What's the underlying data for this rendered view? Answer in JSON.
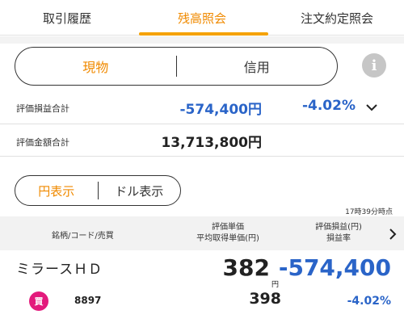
{
  "tabs": [
    {
      "label": "取引履歴",
      "active": false
    },
    {
      "label": "残高照会",
      "active": true
    },
    {
      "label": "注文約定照会",
      "active": false
    }
  ],
  "account_type": {
    "options": [
      "現物",
      "信用"
    ],
    "selected": "現物"
  },
  "info_icon": "info-icon",
  "summary": {
    "pl_label": "評価損益合計",
    "pl_total": "-574,400円",
    "pl_rate": "-4.02%",
    "mv_label": "評価金額合計",
    "mv_total": "13,713,800円"
  },
  "currency": {
    "options": [
      "円表示",
      "ドル表示"
    ],
    "selected": "円表示"
  },
  "timestamp": "17時39分時点",
  "table_header": {
    "col1": "銘柄/コード/売買",
    "col2_line1": "評価単価",
    "col2_line2": "平均取得単価(円)",
    "col3_line1": "評価損益(円)",
    "col3_line2": "損益率"
  },
  "holdings": [
    {
      "name": "ミラースＨＤ",
      "price": "382",
      "price_unit": "円",
      "pl": "-574,400",
      "side": "買",
      "code": "8897",
      "avg_cost": "398",
      "pl_rate": "-4.02%"
    }
  ],
  "colors": {
    "accent": "#f08a00",
    "negative": "#2a64c8",
    "buy_badge": "#e31a7c"
  }
}
